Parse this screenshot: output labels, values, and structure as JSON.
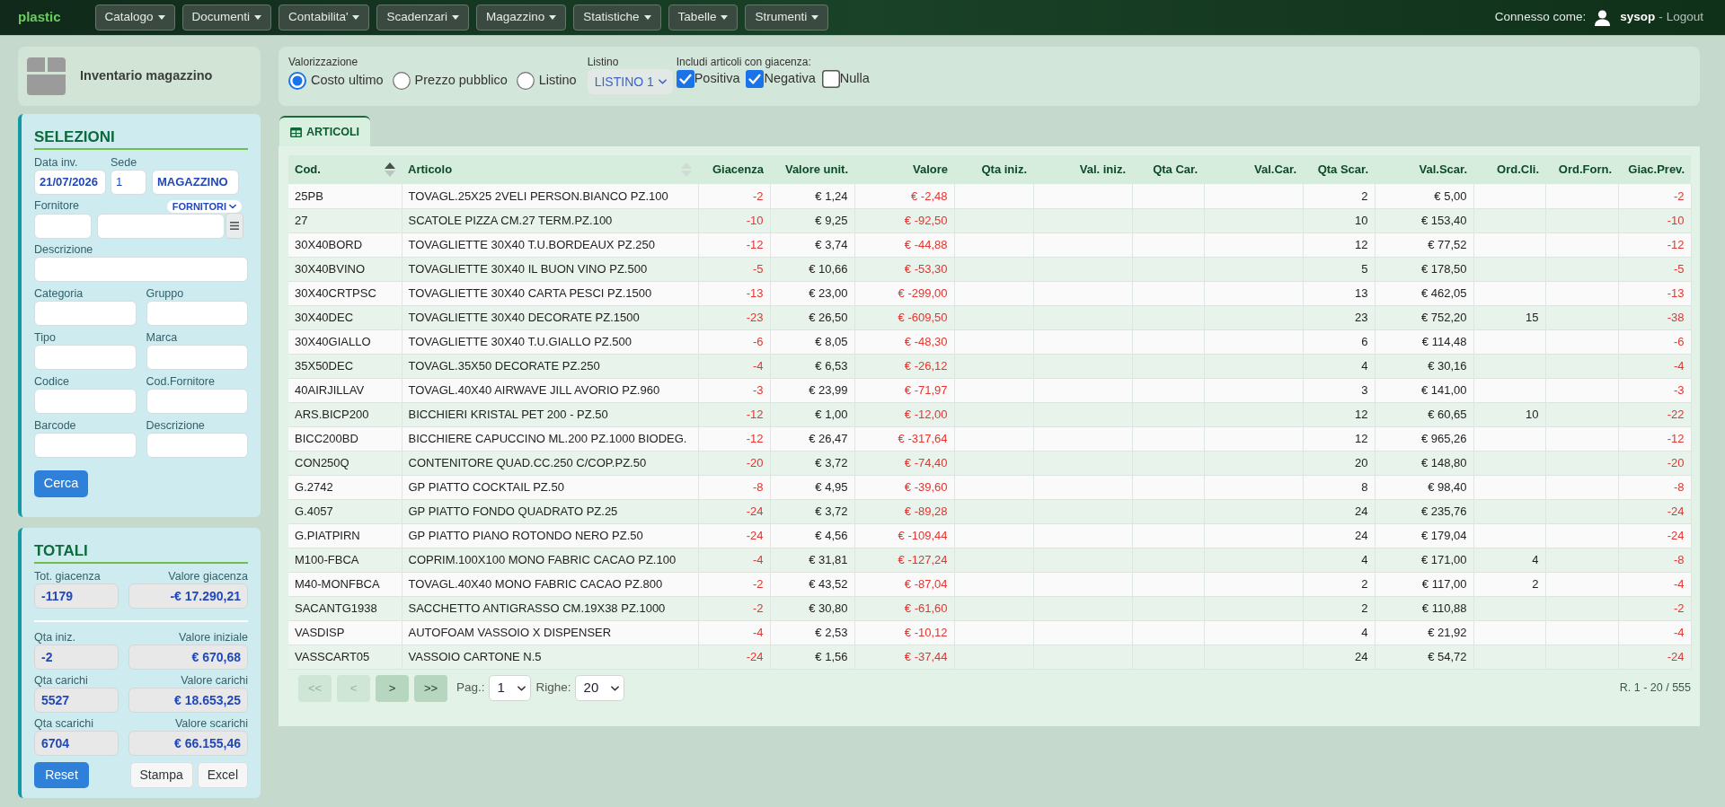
{
  "navbar": {
    "brand": "plastic",
    "menus": [
      {
        "label": "Catalogo"
      },
      {
        "label": "Documenti"
      },
      {
        "label": "Contabilita'"
      },
      {
        "label": "Scadenzari"
      },
      {
        "label": "Magazzino"
      },
      {
        "label": "Statistiche"
      },
      {
        "label": "Tabelle"
      },
      {
        "label": "Strumenti"
      }
    ],
    "user": {
      "prefix": "Connesso come:",
      "name": "sysop",
      "separator": "-",
      "logout": "Logout"
    }
  },
  "page_header": {
    "title": "Inventario magazzino"
  },
  "selezioni": {
    "title": "SELEZIONI",
    "data_inv": {
      "label": "Data inv.",
      "value": "21/07/2026"
    },
    "sede": {
      "label": "Sede",
      "code": "1",
      "name": "MAGAZZINO"
    },
    "fornitore": {
      "label": "Fornitore",
      "source": "FORNITORI"
    },
    "descrizione": {
      "label": "Descrizione"
    },
    "fields": [
      {
        "label": "Categoria"
      },
      {
        "label": "Gruppo"
      },
      {
        "label": "Tipo"
      },
      {
        "label": "Marca"
      },
      {
        "label": "Codice"
      },
      {
        "label": "Cod.Fornitore"
      },
      {
        "label": "Barcode"
      },
      {
        "label": "Descrizione"
      }
    ],
    "search_button": "Cerca"
  },
  "totali": {
    "title": "TOTALI",
    "rows": [
      {
        "qty_label": "Tot. giacenza",
        "qty": "-1179",
        "value_label": "Valore giacenza",
        "value": "-€ 17.290,21"
      },
      {
        "qty_label": "Qta iniz.",
        "qty": "-2",
        "value_label": "Valore iniziale",
        "value": "€ 670,68"
      },
      {
        "qty_label": "Qta carichi",
        "qty": "5527",
        "value_label": "Valore carichi",
        "value": "€ 18.653,25"
      },
      {
        "qty_label": "Qta scarichi",
        "qty": "6704",
        "value_label": "Valore scarichi",
        "value": "€ 66.155,46"
      }
    ],
    "buttons": [
      {
        "label": "Reset",
        "kind": "primary"
      },
      {
        "label": "Stampa",
        "kind": "default"
      },
      {
        "label": "Excel",
        "kind": "default"
      }
    ]
  },
  "options": {
    "valorizzazione": {
      "label": "Valorizzazione",
      "options": [
        {
          "label": "Costo ultimo",
          "selected": true
        },
        {
          "label": "Prezzo pubblico",
          "selected": false
        },
        {
          "label": "Listino",
          "selected": false
        }
      ]
    },
    "listino": {
      "label": "Listino",
      "value": "LISTINO 1"
    },
    "giacenza": {
      "label": "Includi articoli con giacenza:",
      "options": [
        {
          "label": "Positiva",
          "checked": true
        },
        {
          "label": "Negativa",
          "checked": true
        },
        {
          "label": "Nulla",
          "checked": false
        }
      ]
    }
  },
  "tabs": [
    {
      "label": "ARTICOLI",
      "selected": true
    }
  ],
  "table": {
    "columns": [
      {
        "label": "Cod.",
        "kind": "text",
        "sorted": true
      },
      {
        "label": "Articolo",
        "kind": "text",
        "sorted": false
      },
      {
        "label": "Giacenza",
        "kind": "negative"
      },
      {
        "label": "Valore unit.",
        "kind": "number"
      },
      {
        "label": "Valore",
        "kind": "negative"
      },
      {
        "label": "Qta iniz.",
        "kind": "number"
      },
      {
        "label": "Val. iniz.",
        "kind": "number"
      },
      {
        "label": "Qta Car.",
        "kind": "number"
      },
      {
        "label": "Val.Car.",
        "kind": "number"
      },
      {
        "label": "Qta Scar.",
        "kind": "number"
      },
      {
        "label": "Val.Scar.",
        "kind": "number"
      },
      {
        "label": "Ord.Cli.",
        "kind": "number"
      },
      {
        "label": "Ord.Forn.",
        "kind": "number"
      },
      {
        "label": "Giac.Prev.",
        "kind": "negative"
      }
    ],
    "rows": [
      [
        "25PB",
        "TOVAGL.25X25 2VELI PERSON.BIANCO PZ.100",
        "-2",
        "€ 1,24",
        "€ -2,48",
        null,
        null,
        null,
        null,
        "2",
        "€ 5,00",
        null,
        null,
        "-2"
      ],
      [
        "27",
        "SCATOLE PIZZA CM.27 TERM.PZ.100",
        "-10",
        "€ 9,25",
        "€ -92,50",
        null,
        null,
        null,
        null,
        "10",
        "€ 153,40",
        null,
        null,
        "-10"
      ],
      [
        "30X40BORD",
        "TOVAGLIETTE 30X40 T.U.BORDEAUX PZ.250",
        "-12",
        "€ 3,74",
        "€ -44,88",
        null,
        null,
        null,
        null,
        "12",
        "€ 77,52",
        null,
        null,
        "-12"
      ],
      [
        "30X40BVINO",
        "TOVAGLIETTE 30X40 IL BUON VINO PZ.500",
        "-5",
        "€ 10,66",
        "€ -53,30",
        null,
        null,
        null,
        null,
        "5",
        "€ 178,50",
        null,
        null,
        "-5"
      ],
      [
        "30X40CRTPSC",
        "TOVAGLIETTE 30X40 CARTA PESCI PZ.1500",
        "-13",
        "€ 23,00",
        "€ -299,00",
        null,
        null,
        null,
        null,
        "13",
        "€ 462,05",
        null,
        null,
        "-13"
      ],
      [
        "30X40DEC",
        "TOVAGLIETTE 30X40 DECORATE PZ.1500",
        "-23",
        "€ 26,50",
        "€ -609,50",
        null,
        null,
        null,
        null,
        "23",
        "€ 752,20",
        "15",
        null,
        "-38"
      ],
      [
        "30X40GIALLO",
        "TOVAGLIETTE 30X40 T.U.GIALLO PZ.500",
        "-6",
        "€ 8,05",
        "€ -48,30",
        null,
        null,
        null,
        null,
        "6",
        "€ 114,48",
        null,
        null,
        "-6"
      ],
      [
        "35X50DEC",
        "TOVAGL.35X50 DECORATE PZ.250",
        "-4",
        "€ 6,53",
        "€ -26,12",
        null,
        null,
        null,
        null,
        "4",
        "€ 30,16",
        null,
        null,
        "-4"
      ],
      [
        "40AIRJILLAV",
        "TOVAGL.40X40 AIRWAVE JILL AVORIO PZ.960",
        "-3",
        "€ 23,99",
        "€ -71,97",
        null,
        null,
        null,
        null,
        "3",
        "€ 141,00",
        null,
        null,
        "-3"
      ],
      [
        "ARS.BICP200",
        "BICCHIERI KRISTAL PET 200 - PZ.50",
        "-12",
        "€ 1,00",
        "€ -12,00",
        null,
        null,
        null,
        null,
        "12",
        "€ 60,65",
        "10",
        null,
        "-22"
      ],
      [
        "BICC200BD",
        "BICCHIERE CAPUCCINO ML.200 PZ.1000 BIODEG.",
        "-12",
        "€ 26,47",
        "€ -317,64",
        null,
        null,
        null,
        null,
        "12",
        "€ 965,26",
        null,
        null,
        "-12"
      ],
      [
        "CON250Q",
        "CONTENITORE QUAD.CC.250 C/COP.PZ.50",
        "-20",
        "€ 3,72",
        "€ -74,40",
        null,
        null,
        null,
        null,
        "20",
        "€ 148,80",
        null,
        null,
        "-20"
      ],
      [
        "G.2742",
        "GP PIATTO COCKTAIL PZ.50",
        "-8",
        "€ 4,95",
        "€ -39,60",
        null,
        null,
        null,
        null,
        "8",
        "€ 98,40",
        null,
        null,
        "-8"
      ],
      [
        "G.4057",
        "GP PIATTO FONDO QUADRATO PZ.25",
        "-24",
        "€ 3,72",
        "€ -89,28",
        null,
        null,
        null,
        null,
        "24",
        "€ 235,76",
        null,
        null,
        "-24"
      ],
      [
        "G.PIATPIRN",
        "GP PIATTO PIANO ROTONDO NERO PZ.50",
        "-24",
        "€ 4,56",
        "€ -109,44",
        null,
        null,
        null,
        null,
        "24",
        "€ 179,04",
        null,
        null,
        "-24"
      ],
      [
        "M100-FBCA",
        "COPRIM.100X100 MONO FABRIC CACAO PZ.100",
        "-4",
        "€ 31,81",
        "€ -127,24",
        null,
        null,
        null,
        null,
        "4",
        "€ 171,00",
        "4",
        null,
        "-8"
      ],
      [
        "M40-MONFBCA",
        "TOVAGL.40X40 MONO FABRIC CACAO PZ.800",
        "-2",
        "€ 43,52",
        "€ -87,04",
        null,
        null,
        null,
        null,
        "2",
        "€ 117,00",
        "2",
        null,
        "-4"
      ],
      [
        "SACANTG1938",
        "SACCHETTO ANTIGRASSO CM.19X38 PZ.1000",
        "-2",
        "€ 30,80",
        "€ -61,60",
        null,
        null,
        null,
        null,
        "2",
        "€ 110,88",
        null,
        null,
        "-2"
      ],
      [
        "VASDISP",
        "AUTOFOAM VASSOIO X DISPENSER",
        "-4",
        "€ 2,53",
        "€ -10,12",
        null,
        null,
        null,
        null,
        "4",
        "€ 21,92",
        null,
        null,
        "-4"
      ],
      [
        "VASSCART05",
        "VASSOIO CARTONE N.5",
        "-24",
        "€ 1,56",
        "€ -37,44",
        null,
        null,
        null,
        null,
        "24",
        "€ 54,72",
        null,
        null,
        "-24"
      ]
    ]
  },
  "pagination": {
    "buttons": [
      {
        "label": "<<",
        "disabled": true
      },
      {
        "label": "<",
        "disabled": true
      },
      {
        "label": ">",
        "disabled": false
      },
      {
        "label": ">>",
        "disabled": false
      }
    ],
    "page": {
      "label": "Pag.:",
      "value": "1"
    },
    "rows_per_page": {
      "label": "Righe:",
      "value": "20"
    },
    "record_info": "R. 1 - 20 / 555"
  }
}
